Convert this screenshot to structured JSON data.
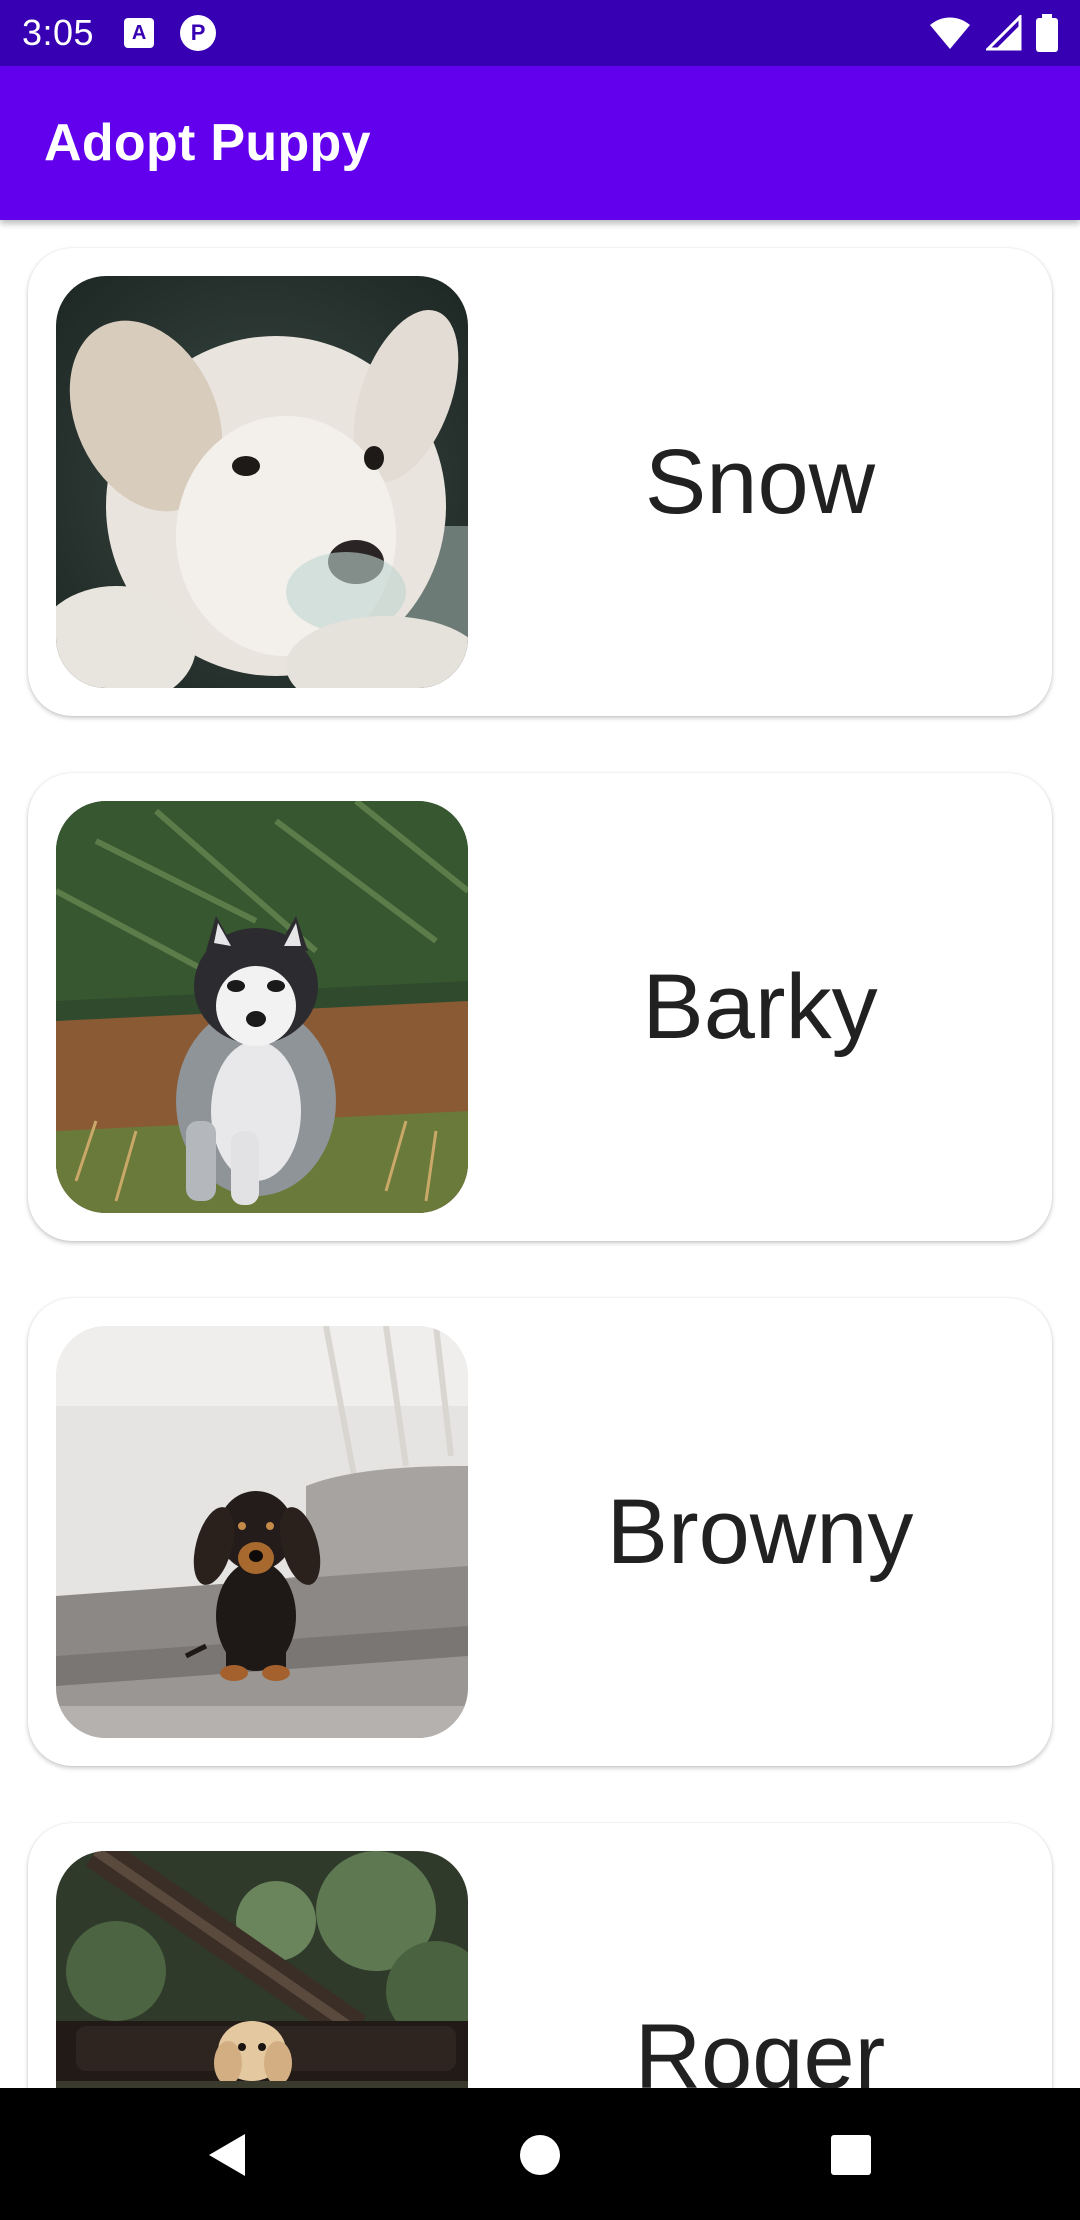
{
  "status_bar": {
    "time": "3:05",
    "notification_icons": [
      "a-notification-icon",
      "p-notification-icon"
    ],
    "system_icons": [
      "wifi-icon",
      "cellular-signal-icon",
      "battery-icon"
    ]
  },
  "app_bar": {
    "title": "Adopt Puppy",
    "color": "#6200ee",
    "status_color": "#3700b3"
  },
  "puppies": [
    {
      "name": "Snow",
      "photo": "white-puppy-photo"
    },
    {
      "name": "Barky",
      "photo": "husky-puppy-photo"
    },
    {
      "name": "Browny",
      "photo": "dachshund-puppy-photo"
    },
    {
      "name": "Roger",
      "photo": "golden-puppy-photo"
    }
  ],
  "nav_bar": {
    "buttons": [
      "back-icon",
      "home-icon",
      "recents-icon"
    ]
  }
}
